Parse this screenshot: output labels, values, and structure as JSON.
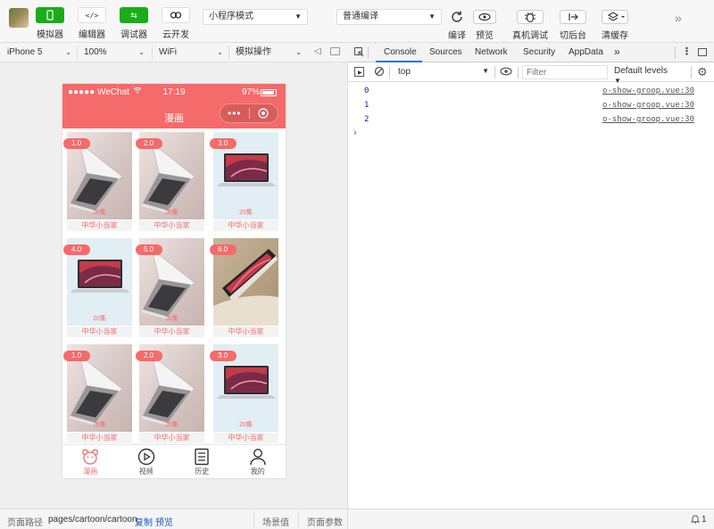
{
  "toolbar": {
    "simulator": "模拟器",
    "editor": "编辑器",
    "debugger": "调试器",
    "cloud": "云开发",
    "mode": "小程序模式",
    "compile_mode": "普通编译",
    "compile": "编译",
    "preview": "预览",
    "remote_debug": "真机调试",
    "background": "切后台",
    "clear_cache": "清缓存"
  },
  "device_bar": {
    "device": "iPhone 5",
    "zoom": "100%",
    "network": "WiFi",
    "operation": "模拟操作"
  },
  "phone": {
    "carrier": "●●●●● WeChat",
    "time": "17:19",
    "battery": "97%",
    "title": "漫画",
    "cards": [
      {
        "badge": "1.0",
        "count": "20集",
        "caption": "中华小当家",
        "img": "silver"
      },
      {
        "badge": "2.0",
        "count": "20集",
        "caption": "中华小当家",
        "img": "silver"
      },
      {
        "badge": "3.0",
        "count": "20集",
        "caption": "中华小当家",
        "img": "screen"
      },
      {
        "badge": "4.0",
        "count": "20集",
        "caption": "中华小当家",
        "img": "screen"
      },
      {
        "badge": "5.0",
        "count": "20集",
        "caption": "中华小当家",
        "img": "silver"
      },
      {
        "badge": "6.0",
        "count": "",
        "caption": "中华小当家",
        "img": "gold"
      },
      {
        "badge": "1.0",
        "count": "20集",
        "caption": "中华小当家",
        "img": "silver"
      },
      {
        "badge": "2.0",
        "count": "20集",
        "caption": "中华小当家",
        "img": "silver"
      },
      {
        "badge": "3.0",
        "count": "20集",
        "caption": "中华小当家",
        "img": "screen"
      }
    ],
    "tabs": [
      {
        "label": "漫画",
        "icon": "cartoon-icon"
      },
      {
        "label": "视频",
        "icon": "video-icon"
      },
      {
        "label": "历史",
        "icon": "history-icon"
      },
      {
        "label": "我的",
        "icon": "user-icon"
      }
    ],
    "accent": "#f56a6a"
  },
  "bottom_bar": {
    "path_label": "页面路径",
    "path": "pages/cartoon/cartoon",
    "copy": "复制",
    "preview": "预览",
    "scene": "场景值",
    "params": "页面参数",
    "notifications": "1"
  },
  "devtools": {
    "tabs": [
      "Console",
      "Sources",
      "Network",
      "Security",
      "AppData"
    ],
    "context": "top",
    "filter_placeholder": "Filter",
    "levels": "Default levels",
    "logs": [
      {
        "value": "0",
        "source": "o-show-groop.vue:30"
      },
      {
        "value": "1",
        "source": "o-show-groop.vue:30"
      },
      {
        "value": "2",
        "source": "o-show-groop.vue:30"
      }
    ],
    "prompt": "›"
  }
}
